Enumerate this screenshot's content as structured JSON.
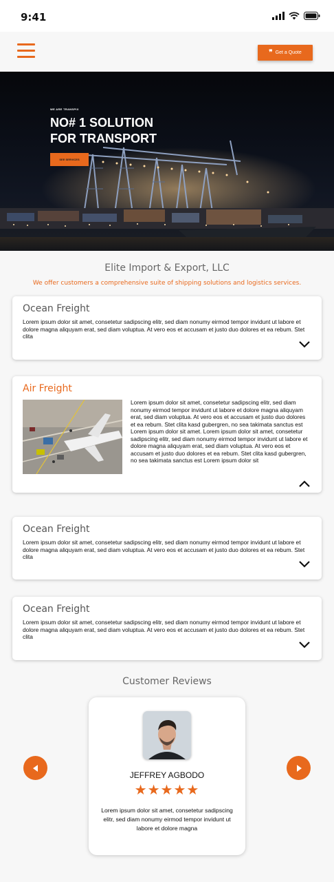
{
  "status_bar": {
    "time": "9:41"
  },
  "nav": {
    "quote_label": "Get a Quote"
  },
  "hero": {
    "kicker": "WE ARE TRANSPIX",
    "title_line1": "NO# 1 SOLUTION",
    "title_line2": "FOR TRANSPORT",
    "button_label": "SEE SERVICES"
  },
  "company": {
    "name": "Elite Import & Export, LLC",
    "tagline": "We offer customers a comprehensive suite of shipping solutions and logistics services."
  },
  "services": [
    {
      "title": "Ocean Freight",
      "text": "Lorem ipsum dolor sit amet, consetetur sadipscing elitr, sed diam nonumy eirmod tempor invidunt ut labore et dolore magna aliquyam erat, sed diam voluptua. At vero eos et accusam et justo duo dolores et ea rebum. Stet clita",
      "expanded": false
    },
    {
      "title": "Air Freight",
      "text": "Lorem ipsum dolor sit amet, consetetur sadipscing elitr, sed diam nonumy eirmod tempor invidunt ut labore et dolore magna aliquyam erat, sed diam voluptua. At vero eos et accusam et justo duo dolores et ea rebum. Stet clita kasd gubergren, no sea takimata sanctus est Lorem ipsum dolor sit amet. Lorem ipsum dolor sit amet, consetetur sadipscing elitr, sed diam nonumy eirmod tempor invidunt ut labore et dolore magna aliquyam erat, sed diam voluptua. At vero eos et accusam et justo duo dolores et ea rebum. Stet clita kasd gubergren, no sea takimata sanctus est Lorem ipsum dolor sit",
      "expanded": true
    },
    {
      "title": "Ocean Freight",
      "text": "Lorem ipsum dolor sit amet, consetetur sadipscing elitr, sed diam nonumy eirmod tempor invidunt ut labore et dolore magna aliquyam erat, sed diam voluptua. At vero eos et accusam et justo duo dolores et ea rebum. Stet clita",
      "expanded": false
    },
    {
      "title": "Ocean Freight",
      "text": "Lorem ipsum dolor sit amet, consetetur sadipscing elitr, sed diam nonumy eirmod tempor invidunt ut labore et dolore magna aliquyam erat, sed diam voluptua. At vero eos et accusam et justo duo dolores et ea rebum. Stet clita",
      "expanded": false
    }
  ],
  "reviews": {
    "heading": "Customer Reviews",
    "name": "JEFFREY AGBODO",
    "stars": "★★★★★",
    "rating": 5,
    "text": "Lorem ipsum dolor sit amet, consetetur sadipscing elitr, sed diam nonumy eirmod tempor invidunt ut labore et dolore magna"
  },
  "colors": {
    "accent": "#e8691d",
    "background": "#f7f7f7",
    "card": "#ffffff"
  },
  "icons": [
    "menu-icon",
    "quote-icon",
    "chevron-down-icon",
    "chevron-up-icon",
    "arrow-left-icon",
    "arrow-right-icon",
    "star-icon",
    "signal-icon",
    "wifi-icon",
    "battery-icon"
  ]
}
